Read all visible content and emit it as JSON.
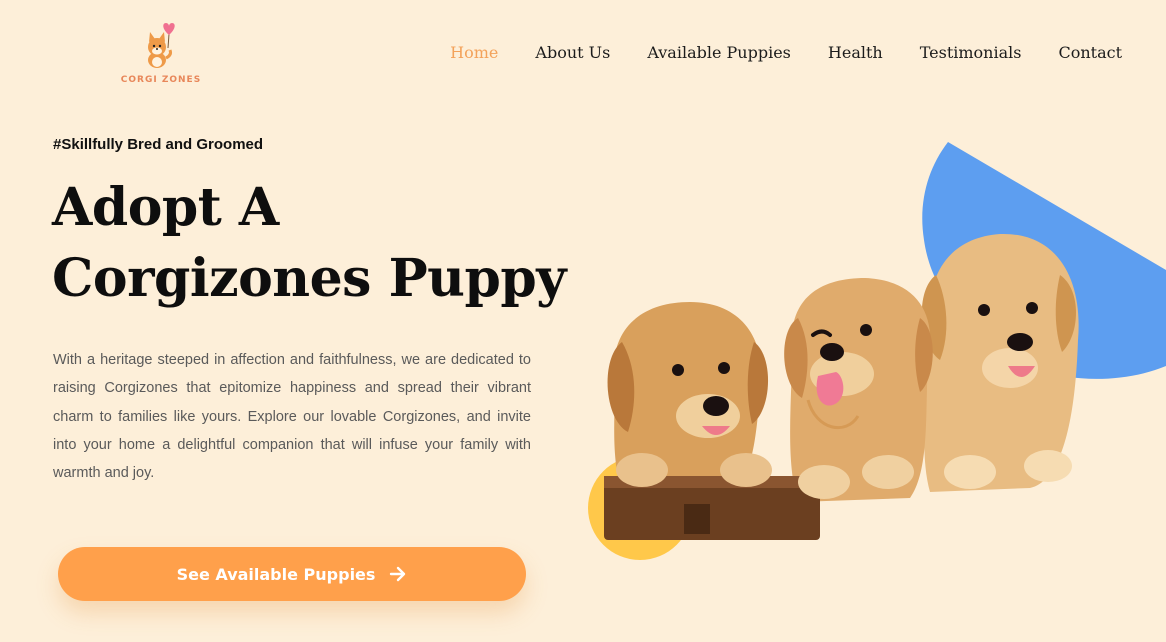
{
  "brand": {
    "name": "CORGI ZONES",
    "accent": "#ffa04b",
    "heart": "#f07090"
  },
  "nav": {
    "items": [
      {
        "label": "Home",
        "active": true
      },
      {
        "label": "About Us"
      },
      {
        "label": "Available Puppies"
      },
      {
        "label": "Health"
      },
      {
        "label": "Testimonials"
      },
      {
        "label": "Contact"
      }
    ]
  },
  "hero": {
    "tagline": "#Skillfully Bred and Groomed",
    "title_line1": "Adopt A",
    "title_line2": "Corgizones Puppy",
    "description": "With a heritage steeped in affection and faithfulness, we are dedicated to raising Corgizones that epitomize happiness and spread their vibrant charm to families like yours. Explore our lovable Corgizones, and invite into your home a delightful companion that will infuse your family with warmth and joy.",
    "cta_label": "See Available Puppies",
    "cta_icon": "arrow-right-icon"
  },
  "colors": {
    "background": "#fdefd9",
    "nav_active": "#f3a25a",
    "blue_shape": "#5d9ef0",
    "yellow_shape": "#ffc84a",
    "puppy_fur": "#e0a868"
  }
}
